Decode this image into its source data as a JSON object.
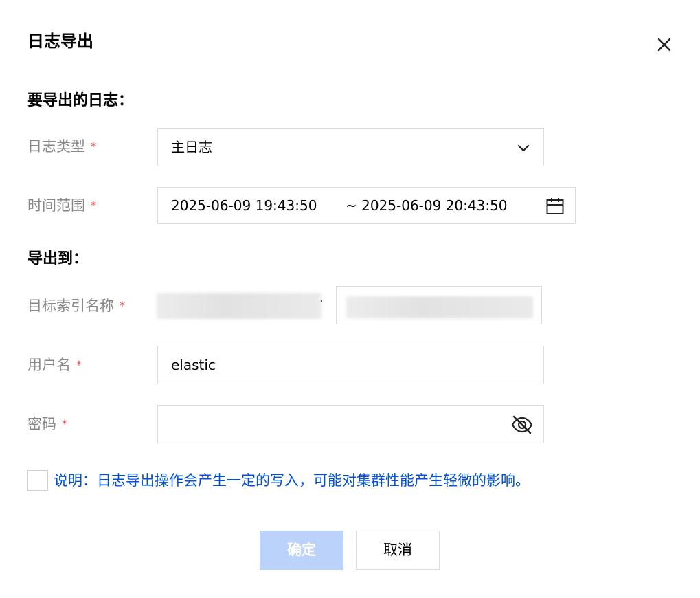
{
  "dialog": {
    "title": "日志导出",
    "close_icon": "close-icon"
  },
  "section_export_logs": {
    "title": "要导出的日志："
  },
  "log_type": {
    "label": "日志类型",
    "required_mark": "*",
    "value": "主日志",
    "icon": "chevron-down-icon"
  },
  "time_range": {
    "label": "时间范围",
    "required_mark": "*",
    "start": "2025-06-09 19:43:50",
    "end": "~ 2025-06-09 20:43:50",
    "icon": "calendar-icon"
  },
  "section_export_to": {
    "title": "导出到："
  },
  "target_index": {
    "label": "目标索引名称",
    "required_mark": "*",
    "separator": "·"
  },
  "username": {
    "label": "用户名",
    "required_mark": "*",
    "value": "elastic"
  },
  "password": {
    "label": "密码",
    "required_mark": "*",
    "value": "",
    "icon": "eye-off-icon"
  },
  "notice": {
    "text": "说明：日志导出操作会产生一定的写入，可能对集群性能产生轻微的影响。",
    "checked": false
  },
  "footer": {
    "confirm_label": "确定",
    "cancel_label": "取消"
  },
  "colors": {
    "label_gray": "#888888",
    "required_red": "#e54545",
    "notice_blue": "#0052d9",
    "confirm_disabled": "#bbd3fb",
    "border": "#dcdcdc"
  }
}
